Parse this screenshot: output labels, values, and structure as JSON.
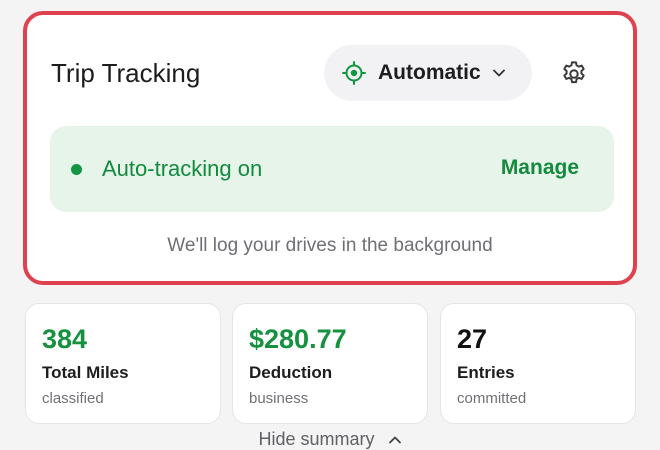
{
  "card": {
    "title": "Trip Tracking",
    "mode_label": "Automatic",
    "status_text": "Auto-tracking on",
    "manage_label": "Manage",
    "helper_text": "We'll log your drives in the background"
  },
  "stats": [
    {
      "value": "384",
      "label": "Total Miles",
      "sub": "classified"
    },
    {
      "value": "$280.77",
      "label": "Deduction",
      "sub": "business"
    },
    {
      "value": "27",
      "label": "Entries",
      "sub": "committed"
    }
  ],
  "summary_toggle": {
    "label": "Hide summary"
  },
  "colors": {
    "accent_green": "#138a3e",
    "banner_bg": "#e7f4e9",
    "highlight_border": "#e0414f"
  },
  "icons": {
    "mode": "location-target-icon",
    "dropdown": "chevron-down-icon",
    "settings": "gear-icon",
    "collapse": "chevron-up-icon"
  }
}
